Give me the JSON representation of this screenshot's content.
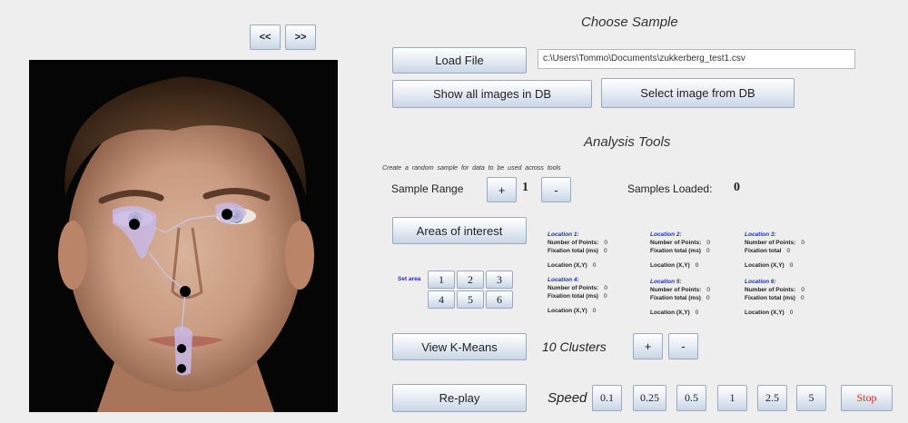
{
  "nav": {
    "prev_label": "<<",
    "next_label": ">>"
  },
  "choose_sample": {
    "title": "Choose Sample",
    "load_file_label": "Load File",
    "file_path_value": "c:\\Users\\Tommo\\Documents\\zukkerberg_test1.csv",
    "show_all_label": "Show all images in DB",
    "select_image_label": "Select image from DB"
  },
  "analysis_tools": {
    "title": "Analysis Tools",
    "note": "Create a random sample for data to be used across tools",
    "sample_range_label": "Sample  Range",
    "plus_label": "+",
    "sample_range_value": "1",
    "minus_label": "-",
    "samples_loaded_label": "Samples  Loaded:",
    "samples_loaded_value": "0",
    "areas_label": "Areas of interest",
    "set_area_label": "Set area",
    "area_buttons": [
      "1",
      "2",
      "3",
      "4",
      "5",
      "6"
    ],
    "locations": [
      {
        "heading": "Location 1:",
        "points_label": "Number of Points:",
        "points": "0",
        "fix_label": "Fixation total (ms)",
        "fix": "0",
        "xy_label": "Location (X,Y)",
        "xy": "0"
      },
      {
        "heading": "Location 2:",
        "points_label": "Number of Points:",
        "points": "0",
        "fix_label": "Fixation total (ms)",
        "fix": "0",
        "xy_label": "Location (X,Y)",
        "xy": "0"
      },
      {
        "heading": "Location 3:",
        "points_label": "Number of Points:",
        "points": "0",
        "fix_label": "Fixation total",
        "fix": "0",
        "xy_label": "Location (X,Y)",
        "xy": "0"
      },
      {
        "heading": "Location 4:",
        "points_label": "Number of Points:",
        "points": "0",
        "fix_label": "Fixation total (ms)",
        "fix": "0",
        "xy_label": "Location (X,Y)",
        "xy": "0"
      },
      {
        "heading": "Location 5:",
        "points_label": "Number of Points:",
        "points": "0",
        "fix_label": "Fixation total (ms)",
        "fix": "0",
        "xy_label": "Location (X,Y)",
        "xy": "0"
      },
      {
        "heading": "Location 6:",
        "points_label": "Number of Points:",
        "points": "0",
        "fix_label": "Fixation total (ms)",
        "fix": "0",
        "xy_label": "Location (X,Y)",
        "xy": "0"
      }
    ],
    "kmeans_label": "View K-Means",
    "clusters_label": "10 Clusters",
    "clusters_plus": "+",
    "clusters_minus": "-",
    "replay_label": "Re-play",
    "speed_label": "Speed",
    "speeds": [
      "0.1",
      "0.25",
      "0.5",
      "1",
      "2.5",
      "5"
    ],
    "stop_label": "Stop",
    "stop_color": "#e0261f"
  },
  "colors": {
    "button_border": "#9aa9bd",
    "location_heading": "#1a2fbf",
    "gaze_overlay": "#c9b8e8"
  }
}
